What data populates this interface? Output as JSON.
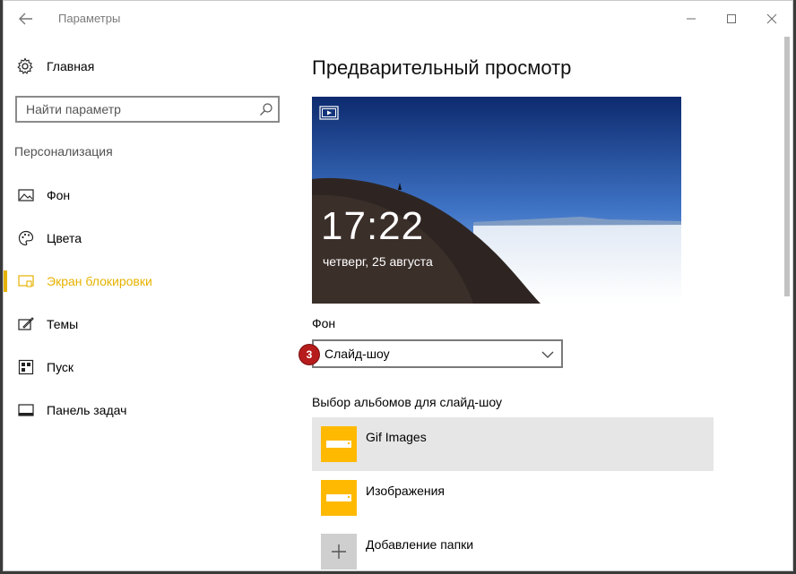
{
  "app": {
    "title": "Параметры"
  },
  "window_controls": {
    "minimize": "minimize",
    "maximize": "maximize",
    "close": "close"
  },
  "sidebar": {
    "home_label": "Главная",
    "search_placeholder": "Найти параметр",
    "section_title": "Персонализация",
    "items": [
      {
        "label": "Фон",
        "icon": "picture-icon",
        "active": false
      },
      {
        "label": "Цвета",
        "icon": "palette-icon",
        "active": false
      },
      {
        "label": "Экран блокировки",
        "icon": "lock-screen-icon",
        "active": true
      },
      {
        "label": "Темы",
        "icon": "themes-icon",
        "active": false
      },
      {
        "label": "Пуск",
        "icon": "start-icon",
        "active": false
      },
      {
        "label": "Панель задач",
        "icon": "taskbar-icon",
        "active": false
      }
    ]
  },
  "main": {
    "title": "Предварительный просмотр",
    "preview": {
      "time": "17:22",
      "date": "четверг, 25 августа",
      "icon": "slideshow-icon"
    },
    "background_label": "Фон",
    "background_value": "Слайд-шоу",
    "step_badge": "3",
    "albums_label": "Выбор альбомов для слайд-шоу",
    "albums": [
      {
        "name": "Gif Images",
        "selected": true,
        "icon": "folder-icon"
      },
      {
        "name": "Изображения",
        "selected": false,
        "icon": "folder-icon"
      },
      {
        "name": "Добавление папки",
        "selected": false,
        "icon": "plus-icon"
      }
    ]
  },
  "colors": {
    "accent": "#e6b200",
    "folder": "#ffb900",
    "badge": "#b71c1c",
    "selected_row": "#e6e6e6"
  }
}
